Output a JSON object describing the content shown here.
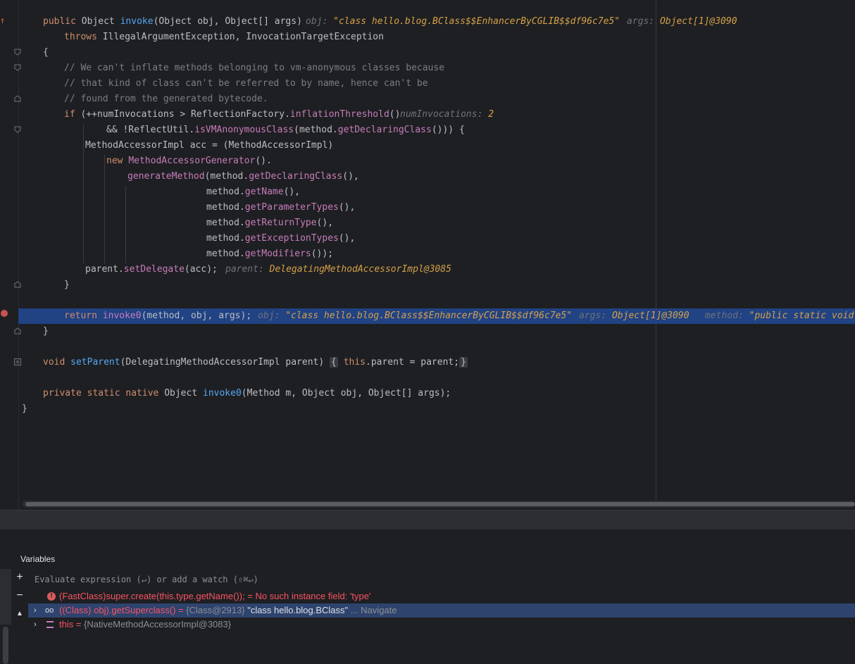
{
  "editor": {
    "lines": {
      "l1": {
        "kw": "public",
        "t1": "Object",
        "fn": "invoke",
        "t2": "(Object",
        "p1": "obj",
        "t3": ", Object[]",
        "p2": "args",
        "t4": ")",
        "h1l": "obj:",
        "h1v": "\"class hello.blog.BClass$$EnhancerByCGLIB$$df96c7e5\"",
        "h2l": "args:",
        "h2v": "Object[1]@3090"
      },
      "l2": {
        "kw": "throws",
        "rest": "IllegalArgumentException, InvocationTargetException"
      },
      "l3": {
        "text": "{"
      },
      "l4": {
        "text": "// We can't inflate methods belonging to vm-anonymous classes because"
      },
      "l5": {
        "text": "// that kind of class can't be referred to by name, hence can't be"
      },
      "l6": {
        "text": "// found from the generated bytecode."
      },
      "l7": {
        "kw": "if",
        "t1": "(++numInvocations > ReflectionFactory.",
        "m1": "inflationThreshold",
        "t2": "()",
        "hl": "numInvocations:",
        "hv": "2"
      },
      "l8": {
        "t1": "&& !ReflectUtil.",
        "m1": "isVMAnonymousClass",
        "t2": "(method.",
        "m2": "getDeclaringClass",
        "t3": "())) {"
      },
      "l9": {
        "t1": "MethodAccessorImpl",
        "p1": "acc",
        "t2": "= (MethodAccessorImpl)"
      },
      "l10": {
        "kw": "new",
        "m1": "MethodAccessorGenerator",
        "t1": "()."
      },
      "l11": {
        "m1": "generateMethod",
        "t1": "(method.",
        "m2": "getDeclaringClass",
        "t2": "(),"
      },
      "l12": {
        "t1": "method.",
        "m1": "getName",
        "t2": "(),"
      },
      "l13": {
        "t1": "method.",
        "m1": "getParameterTypes",
        "t2": "(),"
      },
      "l14": {
        "t1": "method.",
        "m1": "getReturnType",
        "t2": "(),"
      },
      "l15": {
        "t1": "method.",
        "m1": "getExceptionTypes",
        "t2": "(),"
      },
      "l16": {
        "t1": "method.",
        "m1": "getModifiers",
        "t2": "());"
      },
      "l17": {
        "t1": "parent.",
        "m1": "setDelegate",
        "t2": "(acc);",
        "hl": "parent:",
        "hv": "DelegatingMethodAccessorImpl@3085"
      },
      "l18": {
        "text": "}"
      },
      "l20": {
        "kw": "return",
        "m1": "invoke0",
        "t1": "(method,",
        "p1": "obj",
        "t2": ",",
        "p2": "args",
        "t3": ");",
        "h1l": "obj:",
        "h1v": "\"class hello.blog.BClass$$EnhancerByCGLIB$$df96c7e5\"",
        "h2l": "args:",
        "h2v": "Object[1]@3090",
        "h3l": "method:",
        "h3v": "\"public static void m"
      },
      "l21": {
        "text": "}"
      },
      "l23": {
        "kw": "void",
        "fn": "setParent",
        "t1": "(DelegatingMethodAccessorImpl",
        "p1": "parent",
        "t2": ")",
        "b1": "{",
        "kw2": "this",
        "t3": ".parent =",
        "p2": "parent",
        "t4": ";",
        "b2": "}"
      },
      "l25": {
        "kw": "private static native",
        "t1": "Object",
        "fn": "invoke0",
        "t2": "(Method",
        "p1": "m",
        "t3": ", Object",
        "p2": "obj",
        "t4": ", Object[]",
        "p3": "args",
        "t5": ");"
      },
      "l26": {
        "text": "}"
      }
    }
  },
  "panel": {
    "tab_label": "Variables",
    "eval_placeholder": "Evaluate expression (↵) or add a watch (⇧⌘↵)",
    "rows": [
      {
        "expr": "(FastClass)super.create(this.type.getName()); =",
        "msg": "No such instance field: 'type'"
      },
      {
        "expr": "((Class) obj).getSuperclass() =",
        "ref": "{Class@2913}",
        "value": "\"class hello.blog.BClass\"",
        "nav": "... Navigate"
      },
      {
        "expr": "this =",
        "ref": "{NativeMethodAccessorImpl@3083}"
      }
    ],
    "tools": {
      "add": "+",
      "remove": "−",
      "up": "▲"
    }
  },
  "colors": {
    "keyword": "#cf8e6d",
    "method": "#56a8f5",
    "call": "#c77dbb",
    "hint": "#d5a14a",
    "selection": "#214283",
    "error": "#f75464"
  }
}
